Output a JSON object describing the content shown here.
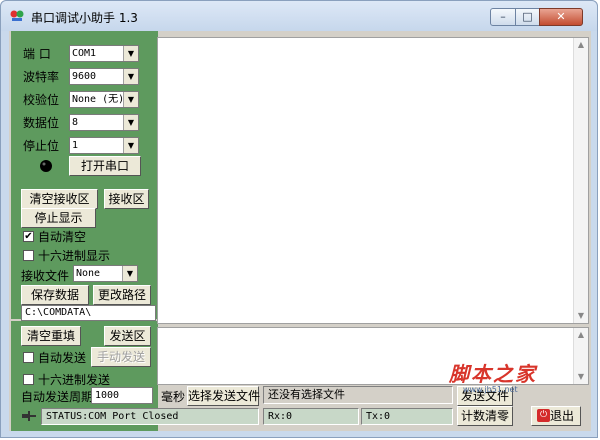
{
  "window": {
    "title": "串口调试小助手 1.3",
    "min_label": "–",
    "max_label": "□",
    "close_label": "✕"
  },
  "settings": {
    "port_label": "端  口",
    "port_value": "COM1",
    "baud_label": "波特率",
    "baud_value": "9600",
    "parity_label": "校验位",
    "parity_value": "None (无)",
    "databits_label": "数据位",
    "databits_value": "8",
    "stopbits_label": "停止位",
    "stopbits_value": "1",
    "open_port_label": "打开串口"
  },
  "receive": {
    "clear_label": "清空接收区",
    "area_label": "接收区",
    "stop_display_label": "停止显示",
    "auto_clear_label": "自动清空",
    "auto_clear_checked": true,
    "hex_display_label": "十六进制显示",
    "hex_display_checked": false,
    "file_label": "接收文件",
    "file_value": "None",
    "save_label": "保存数据",
    "change_path_label": "更改路径",
    "path_value": "C:\\COMDATA\\"
  },
  "send": {
    "clear_label": "清空重填",
    "area_label": "发送区",
    "auto_send_label": "自动发送",
    "auto_send_checked": false,
    "manual_send_label": "手动发送",
    "hex_send_label": "十六进制发送",
    "hex_send_checked": false,
    "period_label": "自动发送周期",
    "period_value": "1000",
    "ms_label": "毫秒",
    "choose_file_label": "选择发送文件",
    "no_file_text": "还没有选择文件",
    "send_file_label": "发送文件"
  },
  "statusbar": {
    "status_text": "STATUS:COM Port Closed",
    "rx_text": "Rx:0",
    "tx_text": "Tx:0",
    "reset_count_label": "计数清零",
    "exit_label": "退出"
  },
  "watermark": {
    "text": "脚本之家",
    "url": "www.jb51.net"
  },
  "colors": {
    "panel_green": "#5e9a5e",
    "window_frame": "#c9d9ec",
    "indicator": "#000000"
  }
}
